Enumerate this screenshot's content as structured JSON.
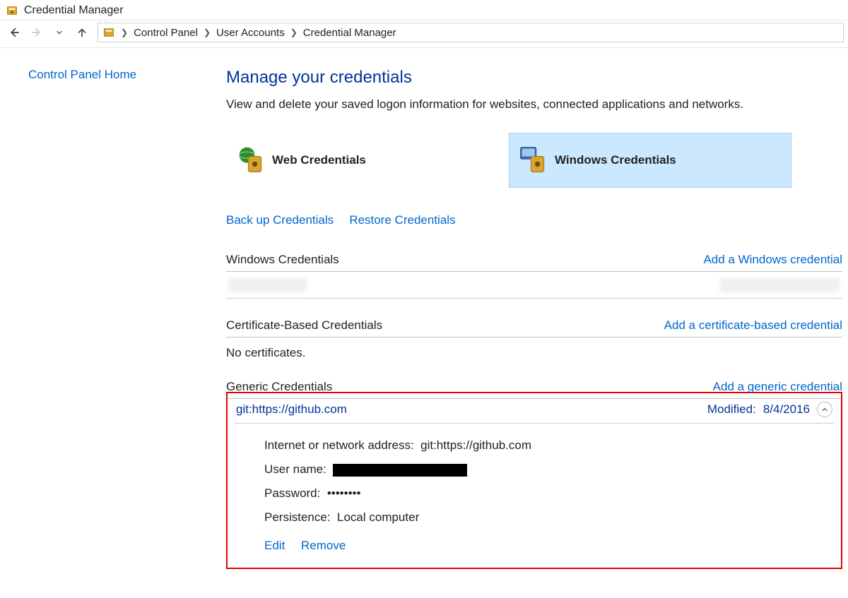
{
  "window": {
    "title": "Credential Manager"
  },
  "breadcrumb": {
    "items": [
      "Control Panel",
      "User Accounts",
      "Credential Manager"
    ]
  },
  "sidebar": {
    "home": "Control Panel Home"
  },
  "page": {
    "heading": "Manage your credentials",
    "description": "View and delete your saved logon information for websites, connected applications and networks."
  },
  "tiles": {
    "web": "Web Credentials",
    "windows": "Windows Credentials"
  },
  "links": {
    "backup": "Back up Credentials",
    "restore": "Restore Credentials"
  },
  "sections": {
    "windows": {
      "title": "Windows Credentials",
      "add": "Add a Windows credential"
    },
    "cert": {
      "title": "Certificate-Based Credentials",
      "add": "Add a certificate-based credential",
      "empty": "No certificates."
    },
    "generic": {
      "title": "Generic Credentials",
      "add": "Add a generic credential"
    }
  },
  "entry": {
    "name": "git:https://github.com",
    "modified_label": "Modified:",
    "modified_date": "8/4/2016",
    "fields": {
      "addr_label": "Internet or network address:",
      "addr_value": "git:https://github.com",
      "user_label": "User name:",
      "pass_label": "Password:",
      "pass_value": "••••••••",
      "persist_label": "Persistence:",
      "persist_value": "Local computer"
    },
    "actions": {
      "edit": "Edit",
      "remove": "Remove"
    }
  }
}
